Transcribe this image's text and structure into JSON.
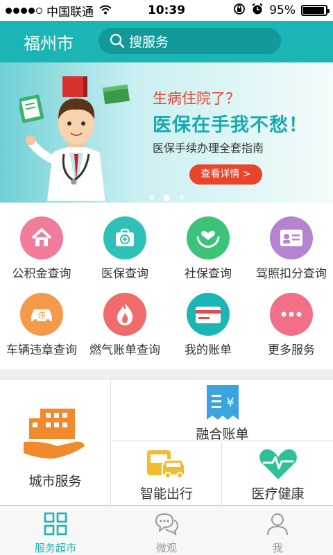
{
  "status_bar": {
    "carrier": "中国联通",
    "time": "10:39",
    "battery": "95%",
    "battery_level": 0.95
  },
  "header": {
    "city": "福州市",
    "search_placeholder": "搜服务"
  },
  "banner": {
    "title": "生病住院了？",
    "headline": "医保在手我不愁！",
    "subtitle": "医保手续办理全套指南",
    "button": "查看详情 >",
    "page_count": 3,
    "active_page": 2
  },
  "services": [
    {
      "label": "公积金查询",
      "icon": "house-icon",
      "color": "#f07b9b"
    },
    {
      "label": "医保查询",
      "icon": "medical-kit-icon",
      "color": "#2fc0b8"
    },
    {
      "label": "社保查询",
      "icon": "heart-hands-icon",
      "color": "#3dc27a"
    },
    {
      "label": "驾照扣分查询",
      "icon": "id-card-icon",
      "color": "#b583d0"
    },
    {
      "label": "车辆违章查询",
      "icon": "car-violation-icon",
      "color": "#f59a4a"
    },
    {
      "label": "燃气账单查询",
      "icon": "flame-icon",
      "color": "#f06b6b"
    },
    {
      "label": "我的账单",
      "icon": "credit-card-icon",
      "color": "#1bb5b5"
    },
    {
      "label": "更多服务",
      "icon": "more-dots-icon",
      "color": "#f26f88"
    }
  ],
  "cards": {
    "city": "城市服务",
    "bill": "融合账单",
    "travel": "智能出行",
    "health": "医疗健康"
  },
  "tabs": [
    {
      "label": "服务超市",
      "icon": "grid-icon",
      "active": true
    },
    {
      "label": "微观",
      "icon": "chat-bubble-icon",
      "active": false
    },
    {
      "label": "我",
      "icon": "user-icon",
      "active": false
    }
  ],
  "colors": {
    "accent": "#1bb5b5",
    "banner_red": "#e8452a",
    "city_orange": "#f08a2c",
    "travel_yellow": "#f4bc2c",
    "health_green": "#2fc09a",
    "bill_blue": "#3aa3e0"
  }
}
